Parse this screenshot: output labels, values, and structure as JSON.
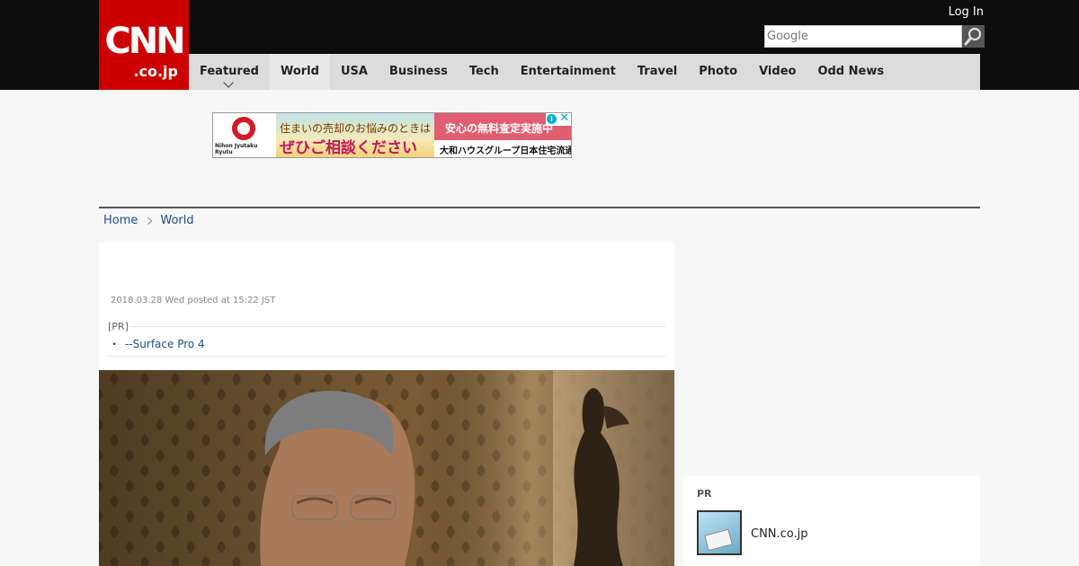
{
  "header": {
    "logo_main": "CNN",
    "logo_sub": ".co.jp",
    "login_label": "Log In",
    "search_placeholder": "Google"
  },
  "nav": {
    "items": [
      {
        "label": "Featured",
        "has_dropdown": true
      },
      {
        "label": "World",
        "active": true
      },
      {
        "label": "USA"
      },
      {
        "label": "Business"
      },
      {
        "label": "Tech"
      },
      {
        "label": "Entertainment"
      },
      {
        "label": "Travel"
      },
      {
        "label": "Photo"
      },
      {
        "label": "Video"
      },
      {
        "label": "Odd News"
      }
    ]
  },
  "ad": {
    "brand": "Nihon Jyutaku Ryutu",
    "line1": "住まいの売却のお悩みのときは",
    "line2": "ぜひご相談ください",
    "badge": "安心の無料査定実施中",
    "sub": "大和ハウスグループ日本住宅流通へ",
    "close": "✕",
    "info": "i"
  },
  "breadcrumb": {
    "home": "Home",
    "current": "World"
  },
  "article": {
    "date": "2018.03.28 Wed posted at 15:22 JST",
    "pr_label": "[PR]",
    "pr_link": "--Surface Pro 4",
    "bullet": "・"
  },
  "sidebar": {
    "pr_label": "PR",
    "item_name": "CNN.co.jp"
  },
  "colors": {
    "brand_red": "#cc0000",
    "link_blue": "#1a4f88",
    "header_black": "#0d0d0d",
    "nav_gray": "#dcdcdc"
  }
}
